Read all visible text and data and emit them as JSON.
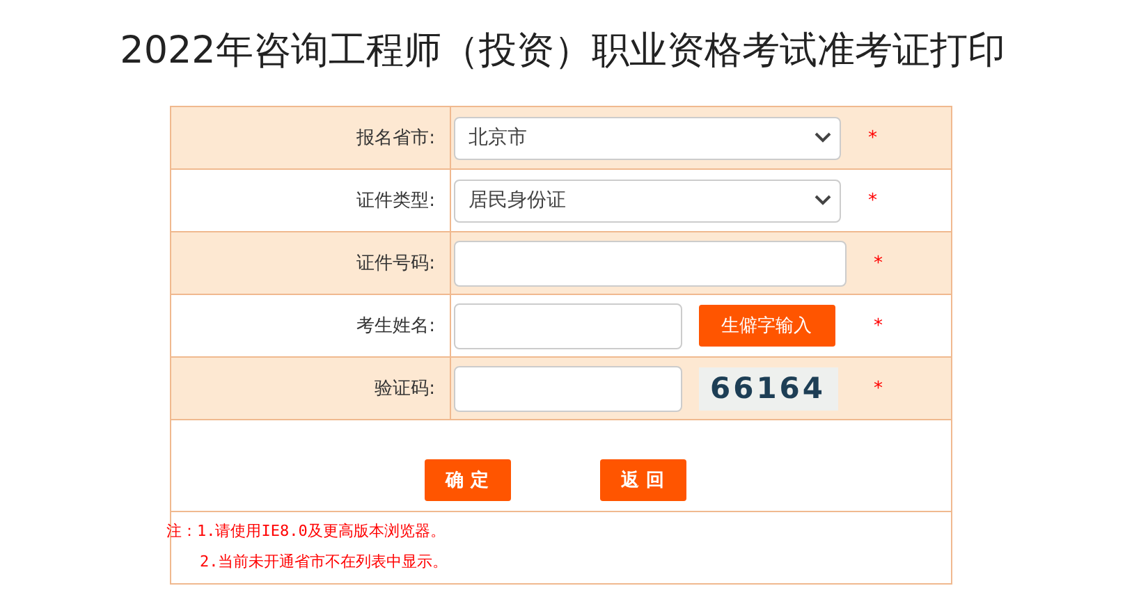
{
  "title": "2022年咨询工程师（投资）职业资格考试准考证打印",
  "rows": [
    {
      "label": "报名省市:",
      "kind": "select",
      "value": "北京市",
      "required": true,
      "shaded": true
    },
    {
      "label": "证件类型:",
      "kind": "select",
      "value": "居民身份证",
      "required": true,
      "shaded": false
    },
    {
      "label": "证件号码:",
      "kind": "input",
      "required": true,
      "shaded": true
    },
    {
      "label": "考生姓名:",
      "kind": "input_button",
      "button": "生僻字输入",
      "required": true,
      "shaded": false
    },
    {
      "label": "验证码:",
      "kind": "captcha",
      "captcha": "66164",
      "required": true,
      "shaded": true
    }
  ],
  "required_mark": "*",
  "actions": [
    "确 定",
    "返 回"
  ],
  "notes": [
    "注：1.请使用IE8.0及更高版本浏览器。",
    "2.当前未开通省市不在列表中显示。"
  ]
}
